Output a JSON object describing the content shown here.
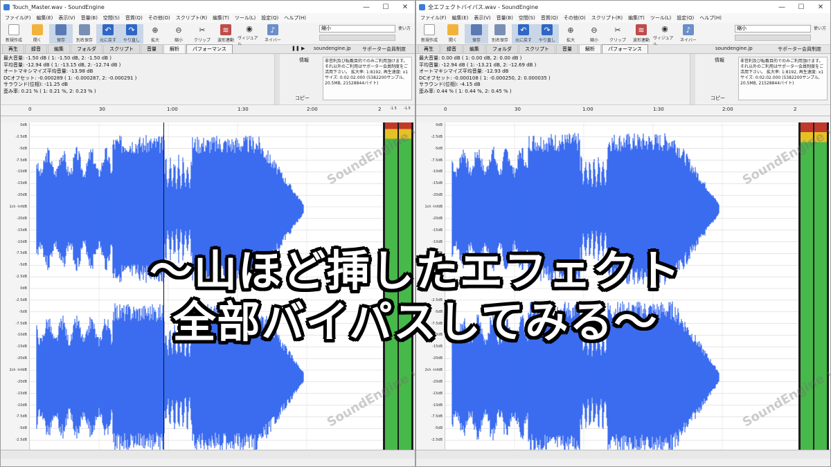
{
  "left": {
    "title": "Touch_Master.wav - SoundEngine",
    "menu": [
      "ファイル(F)",
      "編集(E)",
      "表示(V)",
      "音量(B)",
      "空間(S)",
      "音質(Q)",
      "その他(O)",
      "スクリプト(R)",
      "編集(T)",
      "ツール(L)",
      "設定(Q)",
      "ヘルプ(H)"
    ],
    "toolbar": [
      "新規作成",
      "開く",
      "保存",
      "別名保存",
      "元に戻す",
      "やり直し",
      "拡大",
      "縮小",
      "クリップ",
      "波形連動",
      "ヴィジュアル",
      "ネイバー"
    ],
    "zoom_label": "縮小",
    "usage_label": "使い方",
    "tabs": [
      "再生",
      "録音",
      "編集",
      "フォルダ",
      "スクリプト",
      "音量",
      "解析",
      "パフォーマンス"
    ],
    "extra_left": "soundengine.jp",
    "extra_right": "サポーター会員制度",
    "stats": [
      "最大音量: -1.50 dB ( 1: -1.50 dB, 2: -1.50 dB )",
      "平均音量: -12.94 dB ( 1: -13.15 dB, 2: -12.74 dB )",
      "オートマキシマイズ平均音量: -13.98 dB",
      "DCオフセット: -0.000289 ( 1: -0.000287, 2: -0.000291 )",
      "サラウンド(位相): -11.25 dB",
      "歪み率: 0.21 % ( 1: 0.21 %, 2: 0.23 % )"
    ],
    "info_label": "情報",
    "copy_label": "コピー",
    "info_text": "非営利及び転載目的でのみご利用頂けます。それ以外のご利用はサポーター会員制度をご活用下さい。 拡大率: 1:8192, 再生速度: x1 サイズ: 0:02:02.000 (5382200サンプル, 20.5MB, 21528844バイト)",
    "timeline": [
      "0",
      "30",
      "1:00",
      "1:30",
      "2:00",
      "2"
    ],
    "db_labels": [
      "0dB",
      "-2.5dB",
      "-5dB",
      "-7.5dB",
      "-10dB",
      "-15dB",
      "-20dB",
      "1ch -InfdB",
      "-20dB",
      "-15dB",
      "-10dB",
      "-7.5dB",
      "-5dB",
      "-2.5dB",
      "0dB",
      "-2.5dB",
      "-5dB",
      "-7.5dB",
      "-10dB",
      "-15dB",
      "-20dB",
      "2ch -InfdB",
      "-20dB",
      "-15dB",
      "-10dB",
      "-7.5dB",
      "-5dB",
      "-2.5dB",
      "0dB"
    ],
    "meter_top": [
      "-1.5",
      "-1.5"
    ],
    "meter_channels": [
      "1",
      "2"
    ]
  },
  "right": {
    "title": "全エフェクトバイパス.wav - SoundEngine",
    "stats": [
      "最大音量: 0.00 dB ( 1: 0.00 dB, 2: 0.00 dB )",
      "平均音量: -12.94 dB ( 1: -13.21 dB, 2: -12.69 dB )",
      "オートマキシマイズ平均音量: -12.93 dB",
      "DCオフセット: -0.000108 ( 1: -0.000250, 2: 0.000035 )",
      "サラウンド(位相): -4.15 dB",
      "歪み率: 0.44 % ( 1: 0.44 %, 2: 0.45 % )"
    ],
    "meter_top": [
      "",
      ""
    ],
    "meter_channels": [
      "1",
      "2"
    ]
  },
  "overlay": {
    "line1": "～山ほど挿したエフェクト",
    "line2": "全部バイパスしてみる～"
  },
  "watermark": "SoundEngine v5",
  "colors": {
    "waveform": "#3b6cf0",
    "meter_green": "#47b84a",
    "meter_red": "#c0392b",
    "meter_yellow": "#e5c124"
  }
}
